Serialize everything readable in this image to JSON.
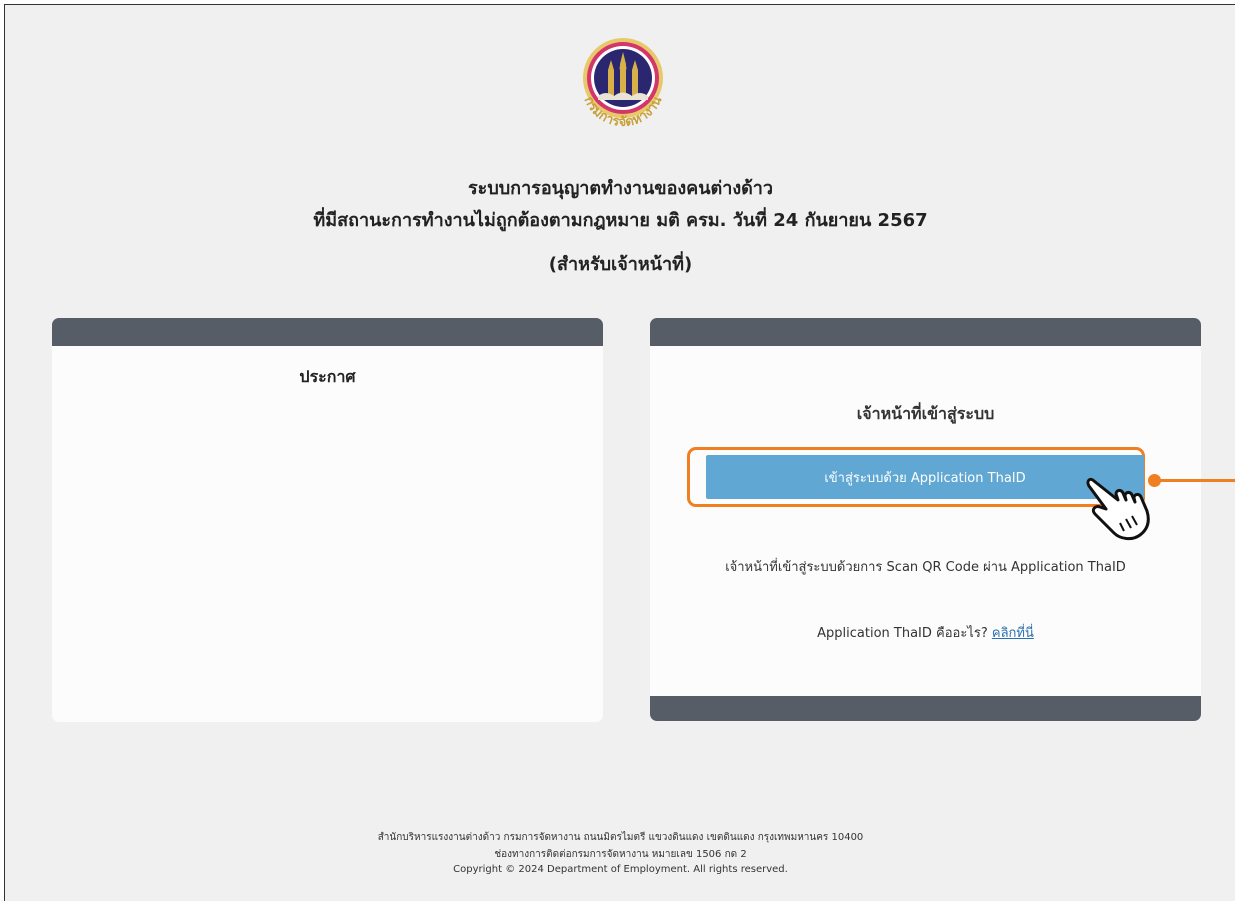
{
  "logo": {
    "org_name_arc": "กรมการจัดหางาน",
    "icon": "department-of-employment-seal"
  },
  "header": {
    "title_line1": "ระบบการอนุญาตทำงานของคนต่างด้าว",
    "title_line2": "ที่มีสถานะการทำงานไม่ถูกต้องตามกฎหมาย มติ ครม. วันที่ 24 กันยายน 2567",
    "title_line3": "(สำหรับเจ้าหน้าที่)"
  },
  "announcement": {
    "title": "ประกาศ"
  },
  "login": {
    "title": "เจ้าหน้าที่เข้าสู่ระบบ",
    "thaid_button_label": "เข้าสู่ระบบด้วย Application ThaID",
    "qr_instruction": "เจ้าหน้าที่เข้าสู่ระบบด้วยการ Scan QR Code ผ่าน Application ThaID",
    "what_is_text": "Application ThaID คืออะไร?",
    "what_is_link": "คลิกที่นี่"
  },
  "annotation": {
    "highlight_color": "#f07f22",
    "pointer_icon": "hand-pointer-icon"
  },
  "footer": {
    "line1": "สำนักบริหารแรงงานต่างด้าว กรมการจัดหางาน ถนนมิตรไมตรี แขวงดินแดง เขตดินแดง กรุงเทพมหานคร 10400",
    "line2": "ช่องทางการติดต่อกรมการจัดหางาน หมายเลข 1506 กด 2",
    "line3": "Copyright © 2024 Department of Employment. All rights reserved."
  },
  "colors": {
    "background": "#f0f0f0",
    "card_bar": "#575d66",
    "button": "#60a8d3",
    "link": "#2a6fb0"
  }
}
